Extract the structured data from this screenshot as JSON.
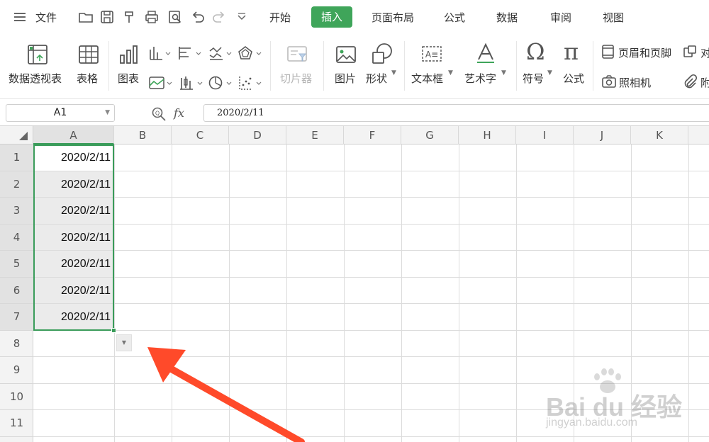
{
  "menubar": {
    "file": "文件",
    "tabs": [
      "开始",
      "插入",
      "页面布局",
      "公式",
      "数据",
      "审阅",
      "视图"
    ],
    "active_tab": "插入"
  },
  "ribbon": {
    "pivot_table": "数据透视表",
    "table": "表格",
    "chart": "图表",
    "slicer": "切片器",
    "picture": "图片",
    "shape": "形状",
    "textbox": "文本框",
    "wordart": "艺术字",
    "symbol": "符号",
    "equation": "公式",
    "header_footer": "页眉和页脚",
    "camera": "照相机",
    "cut_text_1": "对",
    "cut_text_2": "附"
  },
  "formula_bar": {
    "name_box": "A1",
    "fx": "fx",
    "value": "2020/2/11"
  },
  "sheet": {
    "columns": [
      "A",
      "B",
      "C",
      "D",
      "E",
      "F",
      "G",
      "H",
      "I",
      "J",
      "K"
    ],
    "rows": [
      "1",
      "2",
      "3",
      "4",
      "5",
      "6",
      "7",
      "8",
      "9",
      "10",
      "11"
    ],
    "colA": [
      "2020/2/11",
      "2020/2/11",
      "2020/2/11",
      "2020/2/11",
      "2020/2/11",
      "2020/2/11",
      "2020/2/11"
    ],
    "selection_color": "#3a9c5a",
    "accent": "#3fa55a"
  },
  "annotation": {
    "arrow_color": "#ff4a2a"
  },
  "watermark": {
    "line1": "Bai du 经验",
    "line2": "jingyan.baidu.com"
  }
}
